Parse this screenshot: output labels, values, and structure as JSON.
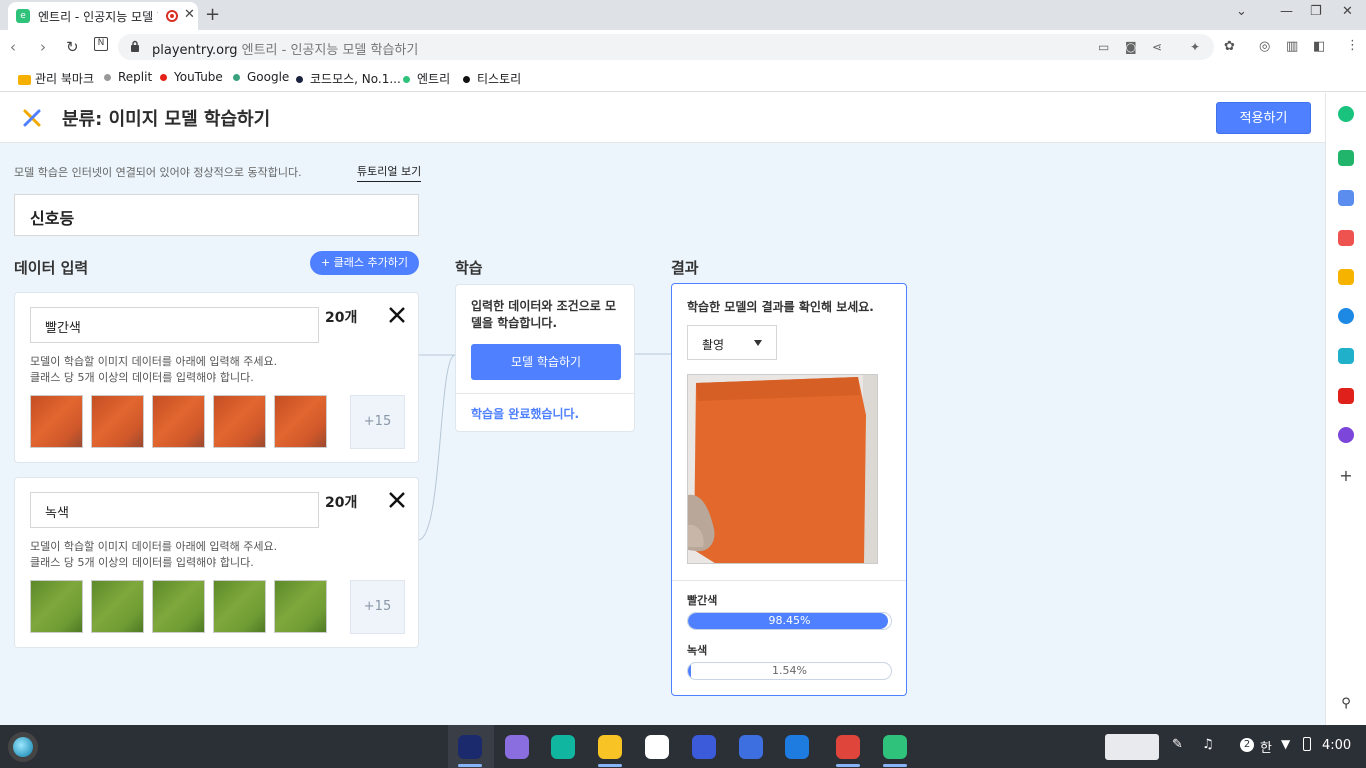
{
  "browser": {
    "tab_title": "엔트리 - 인공지능 모델 학",
    "new_tab": "+",
    "close_tab": "✕",
    "url_domain": "playentry.org",
    "url_rest": "엔트리 - 인공지능 모델 학습하기",
    "bookmarks": [
      {
        "label": "관리 북마크",
        "color": "#f6b000"
      },
      {
        "label": "Replit",
        "color": "#999999"
      },
      {
        "label": "YouTube",
        "color": "#e62117"
      },
      {
        "label": "Google",
        "color": "#3aa17e"
      },
      {
        "label": "코드모스, No.1...",
        "color": "#1c2340"
      },
      {
        "label": "엔트리",
        "color": "#2fc27a"
      },
      {
        "label": "티스토리",
        "color": "#111111"
      }
    ]
  },
  "app": {
    "title": "분류: 이미지 모델 학습하기",
    "apply_label": "적용하기",
    "note": "모델 학습은 인터넷이 연결되어 있어야 정상적으로 동작합니다.",
    "tutorial_label": "튜토리얼 보기",
    "model_name": "신호등",
    "data_input_title": "데이터 입력",
    "add_class_label": "+ 클래스 추가하기",
    "classes": [
      {
        "name": "빨간색",
        "count": "20개",
        "desc_line1": "모델이 학습할 이미지 데이터를 아래에 입력해 주세요.",
        "desc_line2": "클래스 당 5개 이상의 데이터를 입력해야 합니다.",
        "more": "+15"
      },
      {
        "name": "녹색",
        "count": "20개",
        "desc_line1": "모델이 학습할 이미지 데이터를 아래에 입력해 주세요.",
        "desc_line2": "클래스 당 5개 이상의 데이터를 입력해야 합니다.",
        "more": "+15"
      }
    ],
    "learn": {
      "title": "학습",
      "desc": "입력한 데이터와 조건으로 모델을 학습합니다.",
      "button_label": "모델 학습하기",
      "status": "학습을 완료했습니다."
    },
    "result": {
      "title": "결과",
      "desc": "학습한 모델의 결과를 확인해 보세요.",
      "mode": "촬영",
      "predictions": [
        {
          "label": "빨간색",
          "percent_text": "98.45%",
          "value": 98.45
        },
        {
          "label": "녹색",
          "percent_text": "1.54%",
          "value": 1.54
        }
      ]
    }
  },
  "taskbar": {
    "ime": "한",
    "notif_count": "2",
    "time": "4:00"
  },
  "colors": {
    "accent": "#4f80ff",
    "panel_bg": "#ecf5fc"
  }
}
